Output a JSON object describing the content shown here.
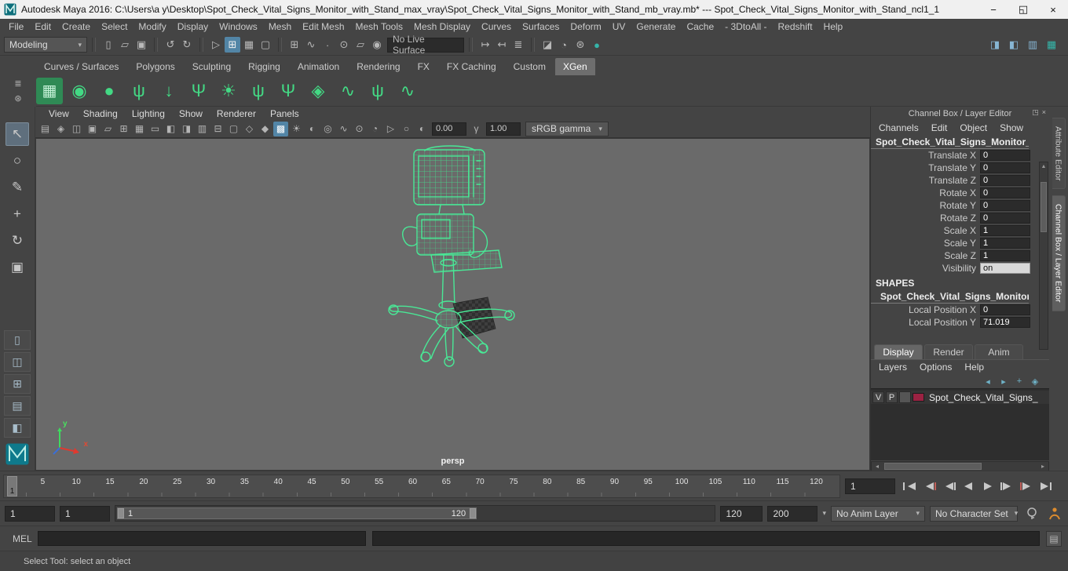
{
  "window": {
    "title": "Autodesk Maya 2016: C:\\Users\\a y\\Desktop\\Spot_Check_Vital_Signs_Monitor_with_Stand_max_vray\\Spot_Check_Vital_Signs_Monitor_with_Stand_mb_vray.mb*   ---   Spot_Check_Vital_Signs_Monitor_with_Stand_ncl1_1",
    "minimize": "−",
    "maximize": "◱",
    "close": "×"
  },
  "glyphs": {
    "chevron_down": "▾",
    "menu": "≣",
    "gear": "⊛",
    "scroll_up": "▲",
    "scroll_down": "▼",
    "scroll_left": "◂",
    "scroll_right": "▸",
    "exposure": "◐",
    "gamma": "γ",
    "script_editor": "▤"
  },
  "colors": {
    "highlight_blue": "#5285a6",
    "wireframe_green": "#49e896",
    "viewport_bg": "#6a6a6a",
    "layer_swatch": "#9b2242"
  },
  "menu_bar": {
    "items": [
      "File",
      "Edit",
      "Create",
      "Select",
      "Modify",
      "Display",
      "Windows",
      "Mesh",
      "Edit Mesh",
      "Mesh Tools",
      "Mesh Display",
      "Curves",
      "Surfaces",
      "Deform",
      "UV",
      "Generate",
      "Cache",
      "- 3DtoAll -",
      "Redshift",
      "Help"
    ]
  },
  "status_line": {
    "mode": "Modeling",
    "file_icons": [
      {
        "name": "new-scene-icon",
        "glyph": "▯"
      },
      {
        "name": "open-scene-icon",
        "glyph": "▱"
      },
      {
        "name": "save-scene-icon",
        "glyph": "▣"
      }
    ],
    "undo_icons": [
      {
        "name": "undo-icon",
        "glyph": "↺"
      },
      {
        "name": "redo-icon",
        "glyph": "↻"
      }
    ],
    "select_icons": [
      {
        "name": "select-hierarchy-icon",
        "glyph": "▷"
      },
      {
        "name": "select-object-icon",
        "glyph": "⊞",
        "active": true
      },
      {
        "name": "select-component-icon",
        "glyph": "▦"
      },
      {
        "name": "select-asset-icon",
        "glyph": "▢"
      }
    ],
    "snap_icons": [
      {
        "name": "snap-to-grids-icon",
        "glyph": "⊞"
      },
      {
        "name": "snap-to-curves-icon",
        "glyph": "∿"
      },
      {
        "name": "snap-to-points-icon",
        "glyph": "∙"
      },
      {
        "name": "snap-to-projected-center-icon",
        "glyph": "⊙"
      },
      {
        "name": "snap-to-view-planes-icon",
        "glyph": "▱"
      },
      {
        "name": "make-live-icon",
        "glyph": "◉"
      }
    ],
    "live_surface": "No Live Surface",
    "history_icons": [
      {
        "name": "input-connections-icon",
        "glyph": "↦"
      },
      {
        "name": "output-connections-icon",
        "glyph": "↤"
      },
      {
        "name": "construction-history-icon",
        "glyph": "≣"
      }
    ],
    "render_icons": [
      {
        "name": "render-current-frame-icon",
        "glyph": "◪"
      },
      {
        "name": "ipr-render-icon",
        "glyph": "◔"
      },
      {
        "name": "render-settings-icon",
        "glyph": "⊛"
      },
      {
        "name": "display-render-view-icon",
        "glyph": "●",
        "cls": "teal"
      }
    ],
    "panel_toggle_icons": [
      {
        "name": "sidebar-attribute-editor-icon",
        "glyph": "◨",
        "cls": "blue"
      },
      {
        "name": "sidebar-tool-settings-icon",
        "glyph": "◧",
        "cls": "blue"
      },
      {
        "name": "sidebar-channel-box-icon",
        "glyph": "▥",
        "cls": "blue"
      },
      {
        "name": "workspace-icon",
        "glyph": "▦",
        "cls": "teal"
      }
    ]
  },
  "shelf": {
    "tabs": [
      {
        "label": "Curves / Surfaces"
      },
      {
        "label": "Polygons"
      },
      {
        "label": "Sculpting"
      },
      {
        "label": "Rigging"
      },
      {
        "label": "Animation"
      },
      {
        "label": "Rendering"
      },
      {
        "label": "FX"
      },
      {
        "label": "FX Caching"
      },
      {
        "label": "Custom"
      },
      {
        "label": "XGen",
        "active": true
      }
    ],
    "icons": [
      {
        "name": "xgen-create-description-icon",
        "glyph": "▦"
      },
      {
        "name": "xgen-inspect-icon",
        "glyph": "◉"
      },
      {
        "name": "xgen-groom-icon",
        "glyph": "●"
      },
      {
        "name": "xgen-add-sop-icon",
        "glyph": "ψ"
      },
      {
        "name": "xgen-export-icon",
        "glyph": "↓"
      },
      {
        "name": "xgen-grass-icon",
        "glyph": "Ψ"
      },
      {
        "name": "xgen-lamp-icon",
        "glyph": "☀"
      },
      {
        "name": "xgen-groomable-splines-icon",
        "glyph": "ψ"
      },
      {
        "name": "xgen-interactive-groom-icon",
        "glyph": "Ψ"
      },
      {
        "name": "xgen-mesh-icon",
        "glyph": "◈"
      },
      {
        "name": "xgen-curves-icon",
        "glyph": "∿"
      },
      {
        "name": "xgen-guides-icon",
        "glyph": "ψ"
      },
      {
        "name": "xgen-modifier-icon",
        "glyph": "∿"
      }
    ]
  },
  "toolbox": {
    "tools": [
      {
        "name": "select-tool",
        "glyph": "↖",
        "active": true
      },
      {
        "name": "lasso-tool",
        "glyph": "○"
      },
      {
        "name": "paint-selection-tool",
        "glyph": "✎"
      },
      {
        "name": "move-tool",
        "glyph": "+"
      },
      {
        "name": "rotate-tool",
        "glyph": "↻"
      },
      {
        "name": "scale-tool",
        "glyph": "▣"
      }
    ],
    "layouts": [
      {
        "name": "layout-single-pane-button",
        "glyph": "▯"
      },
      {
        "name": "layout-two-pane-button",
        "glyph": "◫"
      },
      {
        "name": "layout-four-pane-button",
        "glyph": "⊞"
      },
      {
        "name": "layout-pane-outliner-button",
        "glyph": "▤"
      },
      {
        "name": "layout-pane-split-button",
        "glyph": "◧"
      }
    ]
  },
  "viewport": {
    "menus": [
      "View",
      "Shading",
      "Lighting",
      "Show",
      "Renderer",
      "Panels"
    ],
    "toolbar_icons": [
      {
        "name": "select-camera-icon",
        "glyph": "▤"
      },
      {
        "name": "lock-camera-icon",
        "glyph": "◈"
      },
      {
        "name": "camera-attributes-icon",
        "glyph": "◫"
      },
      {
        "name": "bookmarks-icon",
        "glyph": "▣"
      },
      {
        "name": "image-plane-icon",
        "glyph": "▱"
      },
      {
        "name": "two-d-pan-zoom-icon",
        "glyph": "⊞"
      },
      {
        "name": "grid-icon",
        "glyph": "▦"
      },
      {
        "name": "film-gate-icon",
        "glyph": "▭"
      },
      {
        "name": "resolution-gate-icon",
        "glyph": "◧"
      },
      {
        "name": "gate-mask-icon",
        "glyph": "◨"
      },
      {
        "name": "field-chart-icon",
        "glyph": "▥"
      },
      {
        "name": "safe-action-icon",
        "glyph": "⊟"
      },
      {
        "name": "safe-title-icon",
        "glyph": "▢"
      },
      {
        "name": "wireframe-icon",
        "glyph": "◇"
      },
      {
        "name": "shaded-icon",
        "glyph": "◆"
      },
      {
        "name": "textured-icon",
        "glyph": "▩",
        "active": true
      },
      {
        "name": "use-all-lights-icon",
        "glyph": "☀"
      },
      {
        "name": "shadows-icon",
        "glyph": "◐"
      },
      {
        "name": "screen-space-ao-icon",
        "glyph": "◎"
      },
      {
        "name": "motion-blur-icon",
        "glyph": "∿"
      },
      {
        "name": "multisample-icon",
        "glyph": "⊙"
      },
      {
        "name": "depth-of-field-icon",
        "glyph": "◔"
      },
      {
        "name": "isolate-select-icon",
        "glyph": "▷"
      },
      {
        "name": "xray-icon",
        "glyph": "○"
      }
    ],
    "exposure": "0.00",
    "gamma": "1.00",
    "colorspace": "sRGB gamma",
    "camera": "persp",
    "axis": {
      "x": "x",
      "y": "y"
    }
  },
  "channel_box": {
    "header": "Channel Box / Layer Editor",
    "header_icons": [
      {
        "name": "dock-panel-icon",
        "glyph": "◳"
      },
      {
        "name": "close-panel-icon",
        "glyph": "×"
      }
    ],
    "menus": [
      "Channels",
      "Edit",
      "Object",
      "Show"
    ],
    "object_name": "Spot_Check_Vital_Signs_Monitor_with...",
    "attributes": [
      {
        "label": "Translate X",
        "value": "0"
      },
      {
        "label": "Translate Y",
        "value": "0"
      },
      {
        "label": "Translate Z",
        "value": "0"
      },
      {
        "label": "Rotate X",
        "value": "0"
      },
      {
        "label": "Rotate Y",
        "value": "0"
      },
      {
        "label": "Rotate Z",
        "value": "0"
      },
      {
        "label": "Scale X",
        "value": "1"
      },
      {
        "label": "Scale Y",
        "value": "1"
      },
      {
        "label": "Scale Z",
        "value": "1"
      },
      {
        "label": "Visibility",
        "value": "on",
        "cls": "nonkeyable"
      }
    ],
    "shapes_header": "SHAPES",
    "shape_name": "Spot_Check_Vital_Signs_Monitor_wi...",
    "shape_attributes": [
      {
        "label": "Local Position X",
        "value": "0"
      },
      {
        "label": "Local Position Y",
        "value": "71.019"
      }
    ]
  },
  "layer_editor": {
    "tabs": [
      {
        "label": "Display",
        "active": true
      },
      {
        "label": "Render"
      },
      {
        "label": "Anim"
      }
    ],
    "menus": [
      "Layers",
      "Options",
      "Help"
    ],
    "tool_icons": [
      {
        "name": "move-layer-up-icon",
        "glyph": "◂"
      },
      {
        "name": "move-layer-down-icon",
        "glyph": "▸"
      },
      {
        "name": "create-empty-layer-icon",
        "glyph": "+"
      },
      {
        "name": "create-layer-from-selected-icon",
        "glyph": "◈"
      }
    ],
    "layer": {
      "visible": "V",
      "playback": "P",
      "name": "Spot_Check_Vital_Signs_",
      "swatch_style": "background:#9b2242"
    }
  },
  "side_tabs": [
    {
      "label": "Attribute Editor"
    },
    {
      "label": "Channel Box / Layer Editor",
      "active": true
    }
  ],
  "timeline": {
    "ticks": [
      "5",
      "10",
      "15",
      "20",
      "25",
      "30",
      "35",
      "40",
      "45",
      "50",
      "55",
      "60",
      "65",
      "70",
      "75",
      "80",
      "85",
      "90",
      "95",
      "100",
      "105",
      "110",
      "115",
      "120"
    ],
    "current_frame": "1",
    "frame_field": "1"
  },
  "range_bar": {
    "anim_start": "1",
    "play_start": "1",
    "range_start": "1",
    "range_end": "120",
    "play_end": "120",
    "anim_end": "200",
    "anim_layer": "No Anim Layer",
    "character_set": "No Character Set"
  },
  "command_line": {
    "label": "MEL"
  },
  "help_line": {
    "text": "Select Tool: select an object"
  }
}
